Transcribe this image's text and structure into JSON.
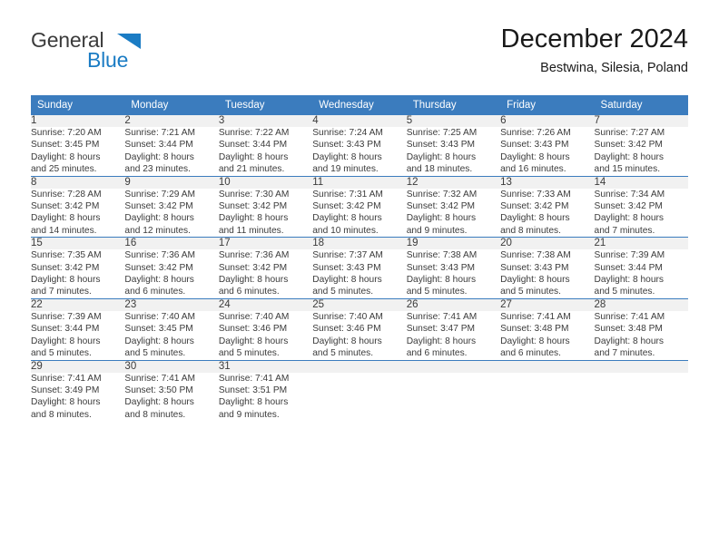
{
  "brand": {
    "name_dark": "General",
    "name_blue": "Blue",
    "accent_color": "#1b7cc4"
  },
  "header": {
    "title": "December 2024",
    "subtitle": "Bestwina, Silesia, Poland"
  },
  "calendar": {
    "header_bg": "#3b7cbe",
    "daynum_bg": "#f1f1f1",
    "weekday_headers": [
      "Sunday",
      "Monday",
      "Tuesday",
      "Wednesday",
      "Thursday",
      "Friday",
      "Saturday"
    ],
    "weeks": [
      [
        {
          "day": "1",
          "sunrise": "Sunrise: 7:20 AM",
          "sunset": "Sunset: 3:45 PM",
          "daylight1": "Daylight: 8 hours",
          "daylight2": "and 25 minutes."
        },
        {
          "day": "2",
          "sunrise": "Sunrise: 7:21 AM",
          "sunset": "Sunset: 3:44 PM",
          "daylight1": "Daylight: 8 hours",
          "daylight2": "and 23 minutes."
        },
        {
          "day": "3",
          "sunrise": "Sunrise: 7:22 AM",
          "sunset": "Sunset: 3:44 PM",
          "daylight1": "Daylight: 8 hours",
          "daylight2": "and 21 minutes."
        },
        {
          "day": "4",
          "sunrise": "Sunrise: 7:24 AM",
          "sunset": "Sunset: 3:43 PM",
          "daylight1": "Daylight: 8 hours",
          "daylight2": "and 19 minutes."
        },
        {
          "day": "5",
          "sunrise": "Sunrise: 7:25 AM",
          "sunset": "Sunset: 3:43 PM",
          "daylight1": "Daylight: 8 hours",
          "daylight2": "and 18 minutes."
        },
        {
          "day": "6",
          "sunrise": "Sunrise: 7:26 AM",
          "sunset": "Sunset: 3:43 PM",
          "daylight1": "Daylight: 8 hours",
          "daylight2": "and 16 minutes."
        },
        {
          "day": "7",
          "sunrise": "Sunrise: 7:27 AM",
          "sunset": "Sunset: 3:42 PM",
          "daylight1": "Daylight: 8 hours",
          "daylight2": "and 15 minutes."
        }
      ],
      [
        {
          "day": "8",
          "sunrise": "Sunrise: 7:28 AM",
          "sunset": "Sunset: 3:42 PM",
          "daylight1": "Daylight: 8 hours",
          "daylight2": "and 14 minutes."
        },
        {
          "day": "9",
          "sunrise": "Sunrise: 7:29 AM",
          "sunset": "Sunset: 3:42 PM",
          "daylight1": "Daylight: 8 hours",
          "daylight2": "and 12 minutes."
        },
        {
          "day": "10",
          "sunrise": "Sunrise: 7:30 AM",
          "sunset": "Sunset: 3:42 PM",
          "daylight1": "Daylight: 8 hours",
          "daylight2": "and 11 minutes."
        },
        {
          "day": "11",
          "sunrise": "Sunrise: 7:31 AM",
          "sunset": "Sunset: 3:42 PM",
          "daylight1": "Daylight: 8 hours",
          "daylight2": "and 10 minutes."
        },
        {
          "day": "12",
          "sunrise": "Sunrise: 7:32 AM",
          "sunset": "Sunset: 3:42 PM",
          "daylight1": "Daylight: 8 hours",
          "daylight2": "and 9 minutes."
        },
        {
          "day": "13",
          "sunrise": "Sunrise: 7:33 AM",
          "sunset": "Sunset: 3:42 PM",
          "daylight1": "Daylight: 8 hours",
          "daylight2": "and 8 minutes."
        },
        {
          "day": "14",
          "sunrise": "Sunrise: 7:34 AM",
          "sunset": "Sunset: 3:42 PM",
          "daylight1": "Daylight: 8 hours",
          "daylight2": "and 7 minutes."
        }
      ],
      [
        {
          "day": "15",
          "sunrise": "Sunrise: 7:35 AM",
          "sunset": "Sunset: 3:42 PM",
          "daylight1": "Daylight: 8 hours",
          "daylight2": "and 7 minutes."
        },
        {
          "day": "16",
          "sunrise": "Sunrise: 7:36 AM",
          "sunset": "Sunset: 3:42 PM",
          "daylight1": "Daylight: 8 hours",
          "daylight2": "and 6 minutes."
        },
        {
          "day": "17",
          "sunrise": "Sunrise: 7:36 AM",
          "sunset": "Sunset: 3:42 PM",
          "daylight1": "Daylight: 8 hours",
          "daylight2": "and 6 minutes."
        },
        {
          "day": "18",
          "sunrise": "Sunrise: 7:37 AM",
          "sunset": "Sunset: 3:43 PM",
          "daylight1": "Daylight: 8 hours",
          "daylight2": "and 5 minutes."
        },
        {
          "day": "19",
          "sunrise": "Sunrise: 7:38 AM",
          "sunset": "Sunset: 3:43 PM",
          "daylight1": "Daylight: 8 hours",
          "daylight2": "and 5 minutes."
        },
        {
          "day": "20",
          "sunrise": "Sunrise: 7:38 AM",
          "sunset": "Sunset: 3:43 PM",
          "daylight1": "Daylight: 8 hours",
          "daylight2": "and 5 minutes."
        },
        {
          "day": "21",
          "sunrise": "Sunrise: 7:39 AM",
          "sunset": "Sunset: 3:44 PM",
          "daylight1": "Daylight: 8 hours",
          "daylight2": "and 5 minutes."
        }
      ],
      [
        {
          "day": "22",
          "sunrise": "Sunrise: 7:39 AM",
          "sunset": "Sunset: 3:44 PM",
          "daylight1": "Daylight: 8 hours",
          "daylight2": "and 5 minutes."
        },
        {
          "day": "23",
          "sunrise": "Sunrise: 7:40 AM",
          "sunset": "Sunset: 3:45 PM",
          "daylight1": "Daylight: 8 hours",
          "daylight2": "and 5 minutes."
        },
        {
          "day": "24",
          "sunrise": "Sunrise: 7:40 AM",
          "sunset": "Sunset: 3:46 PM",
          "daylight1": "Daylight: 8 hours",
          "daylight2": "and 5 minutes."
        },
        {
          "day": "25",
          "sunrise": "Sunrise: 7:40 AM",
          "sunset": "Sunset: 3:46 PM",
          "daylight1": "Daylight: 8 hours",
          "daylight2": "and 5 minutes."
        },
        {
          "day": "26",
          "sunrise": "Sunrise: 7:41 AM",
          "sunset": "Sunset: 3:47 PM",
          "daylight1": "Daylight: 8 hours",
          "daylight2": "and 6 minutes."
        },
        {
          "day": "27",
          "sunrise": "Sunrise: 7:41 AM",
          "sunset": "Sunset: 3:48 PM",
          "daylight1": "Daylight: 8 hours",
          "daylight2": "and 6 minutes."
        },
        {
          "day": "28",
          "sunrise": "Sunrise: 7:41 AM",
          "sunset": "Sunset: 3:48 PM",
          "daylight1": "Daylight: 8 hours",
          "daylight2": "and 7 minutes."
        }
      ],
      [
        {
          "day": "29",
          "sunrise": "Sunrise: 7:41 AM",
          "sunset": "Sunset: 3:49 PM",
          "daylight1": "Daylight: 8 hours",
          "daylight2": "and 8 minutes."
        },
        {
          "day": "30",
          "sunrise": "Sunrise: 7:41 AM",
          "sunset": "Sunset: 3:50 PM",
          "daylight1": "Daylight: 8 hours",
          "daylight2": "and 8 minutes."
        },
        {
          "day": "31",
          "sunrise": "Sunrise: 7:41 AM",
          "sunset": "Sunset: 3:51 PM",
          "daylight1": "Daylight: 8 hours",
          "daylight2": "and 9 minutes."
        },
        {
          "day": "",
          "sunrise": "",
          "sunset": "",
          "daylight1": "",
          "daylight2": ""
        },
        {
          "day": "",
          "sunrise": "",
          "sunset": "",
          "daylight1": "",
          "daylight2": ""
        },
        {
          "day": "",
          "sunrise": "",
          "sunset": "",
          "daylight1": "",
          "daylight2": ""
        },
        {
          "day": "",
          "sunrise": "",
          "sunset": "",
          "daylight1": "",
          "daylight2": ""
        }
      ]
    ]
  }
}
